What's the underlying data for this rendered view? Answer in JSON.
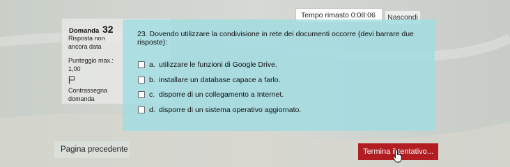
{
  "timer": {
    "label": "Tempo rimasto",
    "value": "0:08:06"
  },
  "hide_button": "Nascondi",
  "info": {
    "question_prefix": "Domanda",
    "question_number": "32",
    "state": "Risposta non ancora data",
    "grade": "Punteggio max.: 1,00",
    "flag_label": "Contrassegna domanda"
  },
  "question": {
    "text": "23. Dovendo utilizzare la condivisione in rete dei documenti occorre (devi barrare due risposte):",
    "answers": [
      {
        "letter": "a.",
        "text": "utilizzare le funzioni di Google Drive."
      },
      {
        "letter": "b.",
        "text": "installare un database capace a farlo."
      },
      {
        "letter": "c.",
        "text": "disporre di un collegamento a Internet."
      },
      {
        "letter": "d.",
        "text": "disporre di un sistema operativo aggiornato."
      }
    ]
  },
  "nav": {
    "prev": "Pagina precedente",
    "finish": "Termina il tentativo..."
  },
  "colors": {
    "panel": "#a0dce2",
    "finish": "#b11d21",
    "background": "#cfd3cf"
  },
  "icons": [
    "flag-icon",
    "cursor-icon"
  ]
}
